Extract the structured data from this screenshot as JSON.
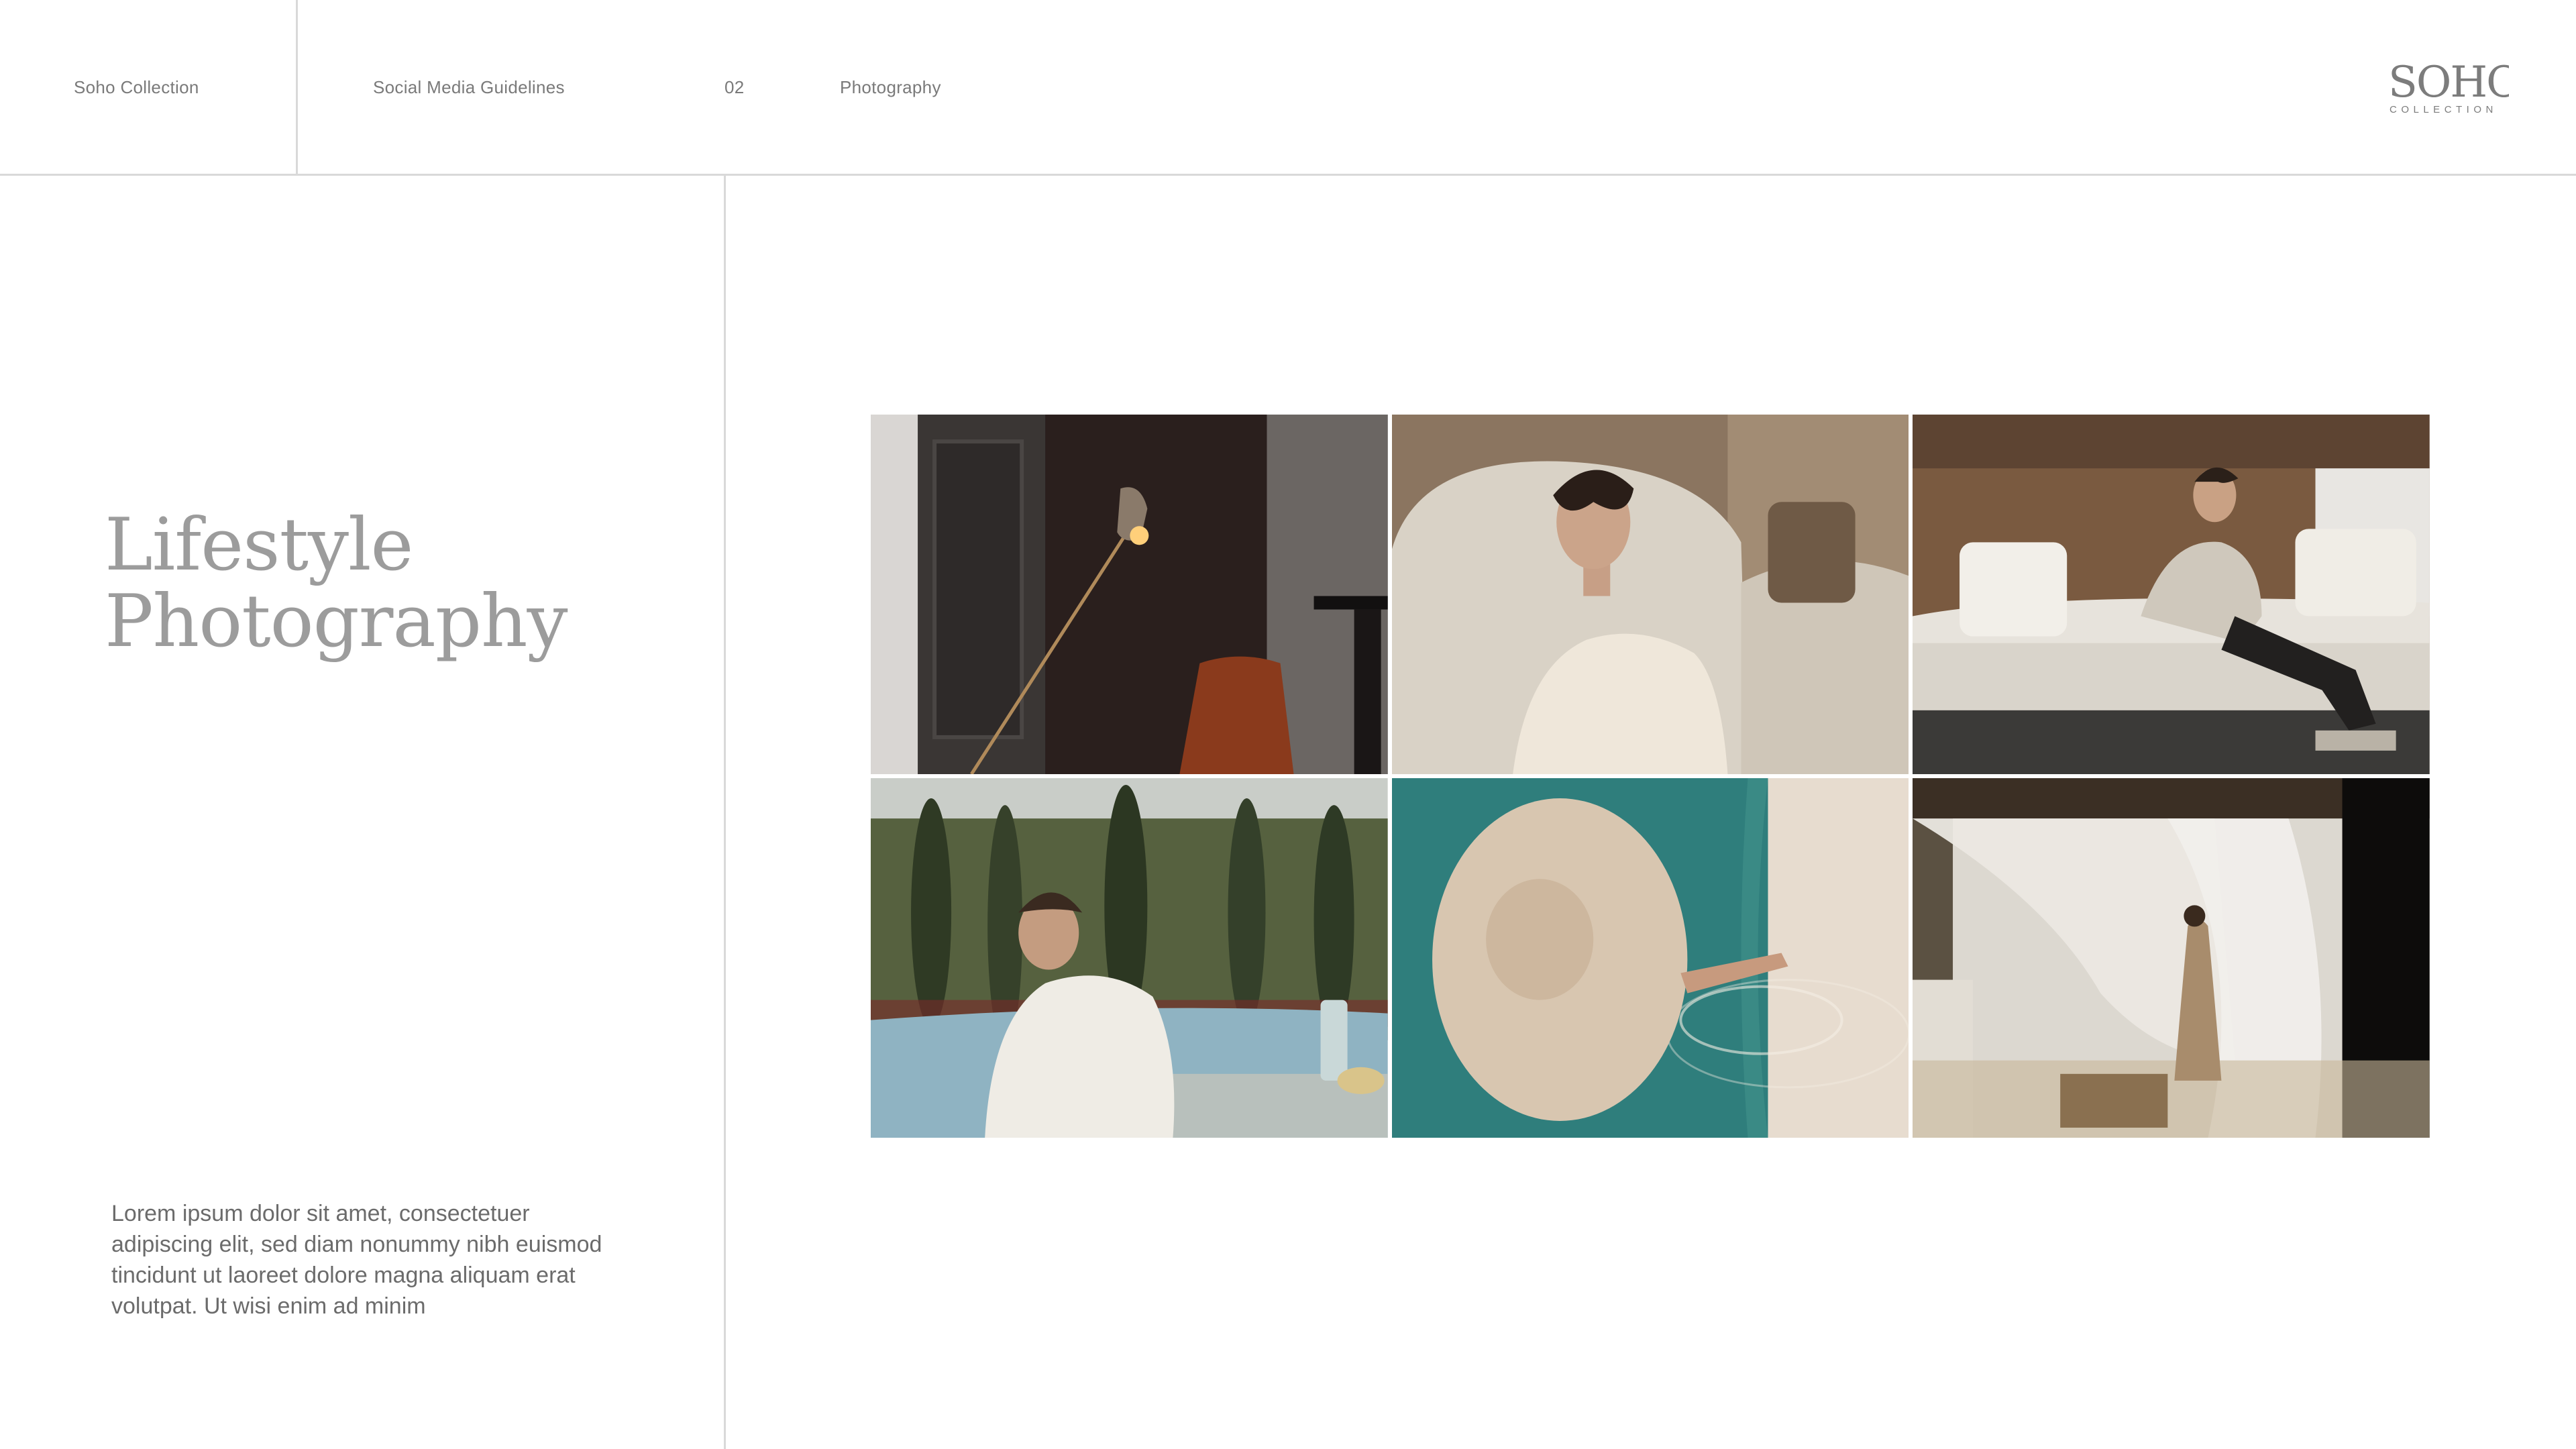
{
  "header": {
    "brand": "Soho Collection",
    "section": "Social Media Guidelines",
    "page_number": "02",
    "chapter": "Photography"
  },
  "logo": {
    "wordmark": "SOHO",
    "tagline": "COLLECTION"
  },
  "main": {
    "title_line1": "Lifestyle",
    "title_line2": "Photography",
    "description": "Lorem ipsum dolor sit amet, consectetuer adipiscing elit, sed diam nonummy nibh euismod tincidunt ut laoreet dolore magna aliquam erat volutpat. Ut wisi enim ad minim"
  },
  "gallery": {
    "photos": [
      {
        "name": "interior-lamp-chair-photo"
      },
      {
        "name": "woman-seated-armchair-photo"
      },
      {
        "name": "man-reading-on-sofa-photo"
      },
      {
        "name": "man-outdoor-terrace-photo"
      },
      {
        "name": "sunhat-in-pool-photo"
      },
      {
        "name": "woman-by-curtains-photo"
      }
    ]
  }
}
